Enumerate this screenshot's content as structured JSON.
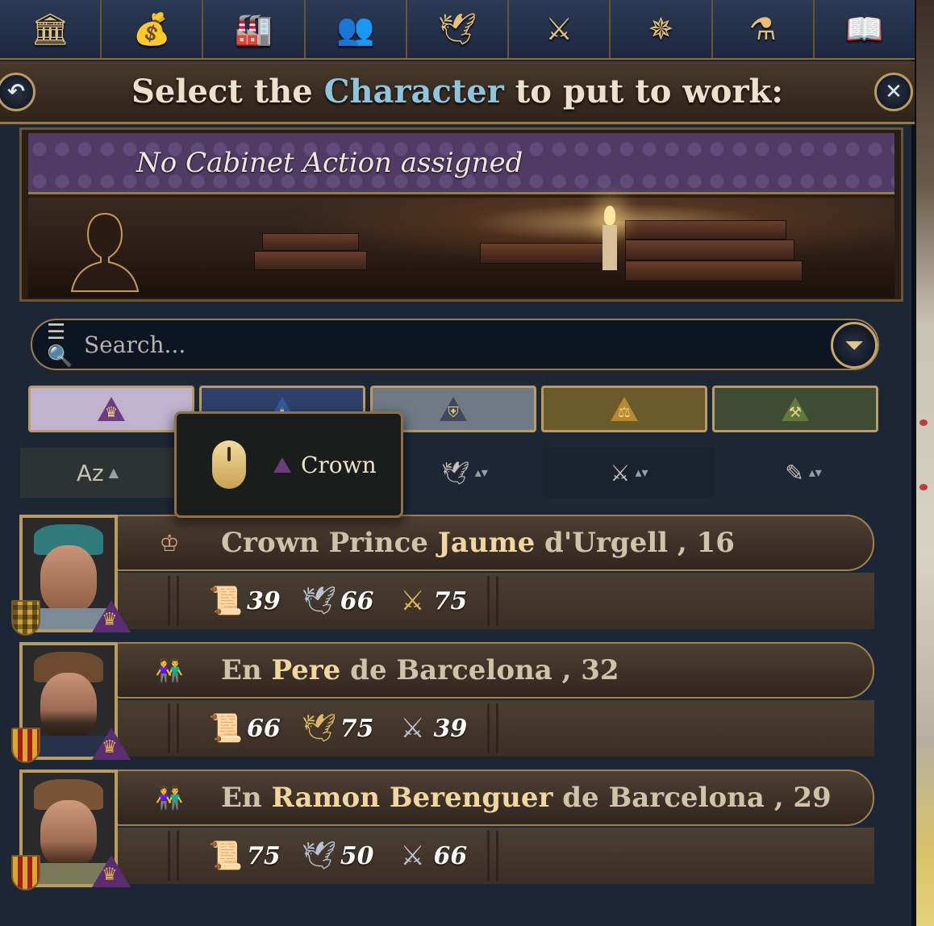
{
  "toolbar": {
    "tabs": [
      {
        "icon": "government-icon",
        "glyph": "🏛"
      },
      {
        "icon": "economy-icon",
        "glyph": "💰"
      },
      {
        "icon": "production-icon",
        "glyph": "🏭"
      },
      {
        "icon": "court-icon",
        "glyph": "👥"
      },
      {
        "icon": "diplomacy-icon",
        "glyph": "🕊"
      },
      {
        "icon": "military-icon",
        "glyph": "⚔"
      },
      {
        "icon": "exploration-icon",
        "glyph": "✵"
      },
      {
        "icon": "advances-icon",
        "glyph": "⚗"
      },
      {
        "icon": "codex-icon",
        "glyph": "📖"
      }
    ]
  },
  "dialog": {
    "title_prefix": "Select the ",
    "title_highlight": "Character",
    "title_suffix": " to put to work:",
    "back_glyph": "↶",
    "close_glyph": "✕"
  },
  "action": {
    "header": "No Cabinet Action assigned"
  },
  "search": {
    "placeholder": "Search...",
    "icon": "search-list-icon",
    "icon_glyph": "☰🔍",
    "filter_glyph": "⏷"
  },
  "category_tabs": [
    {
      "name": "crown",
      "color": "#bfb3cf",
      "glyph": "♛"
    },
    {
      "name": "clergy",
      "color": "#2e3f6a",
      "glyph": "⛪"
    },
    {
      "name": "nobility",
      "color": "#6f7a86",
      "glyph": "⛨"
    },
    {
      "name": "burghers",
      "color": "#6b5a2c",
      "glyph": "⚖"
    },
    {
      "name": "peasants",
      "color": "#3f4b33",
      "glyph": "⚒"
    }
  ],
  "sort_columns": [
    {
      "icon": "alphabetical-sort-icon",
      "glyph": "Aᴢ",
      "arrow": "▲"
    },
    {
      "icon": "diplomacy-sort-icon",
      "glyph": "🕊",
      "arrow": "▴▾"
    },
    {
      "icon": "military-sort-icon",
      "glyph": "⚔",
      "arrow": "▴▾"
    },
    {
      "icon": "administrative-sort-icon",
      "glyph": "✎",
      "arrow": "▴▾"
    }
  ],
  "tooltip": {
    "label": "Crown"
  },
  "characters": [
    {
      "title": "Crown Prince ",
      "name": "Jaume",
      "house": " d'Urgell",
      "age": " , 16",
      "role_glyph": "♔",
      "stats": [
        {
          "icon": "administrative-icon",
          "glyph": "📜",
          "value": "39"
        },
        {
          "icon": "diplomatic-icon",
          "glyph": "🕊",
          "value": "66"
        },
        {
          "icon": "military-icon",
          "glyph": "⚔",
          "value": "75"
        }
      ]
    },
    {
      "title": "En ",
      "name": "Pere",
      "house": " de Barcelona",
      "age": " , 32",
      "role_glyph": "👫",
      "stats": [
        {
          "icon": "administrative-icon",
          "glyph": "📜",
          "value": "66"
        },
        {
          "icon": "diplomatic-icon",
          "glyph": "🕊",
          "value": "75"
        },
        {
          "icon": "military-icon",
          "glyph": "⚔",
          "value": "39"
        }
      ]
    },
    {
      "title": "En ",
      "name": "Ramon Berenguer",
      "house": " de Barcelona",
      "age": " , 29",
      "role_glyph": "👫",
      "stats": [
        {
          "icon": "administrative-icon",
          "glyph": "📜",
          "value": "75"
        },
        {
          "icon": "diplomatic-icon",
          "glyph": "🕊",
          "value": "50"
        },
        {
          "icon": "military-icon",
          "glyph": "⚔",
          "value": "66"
        }
      ]
    }
  ]
}
